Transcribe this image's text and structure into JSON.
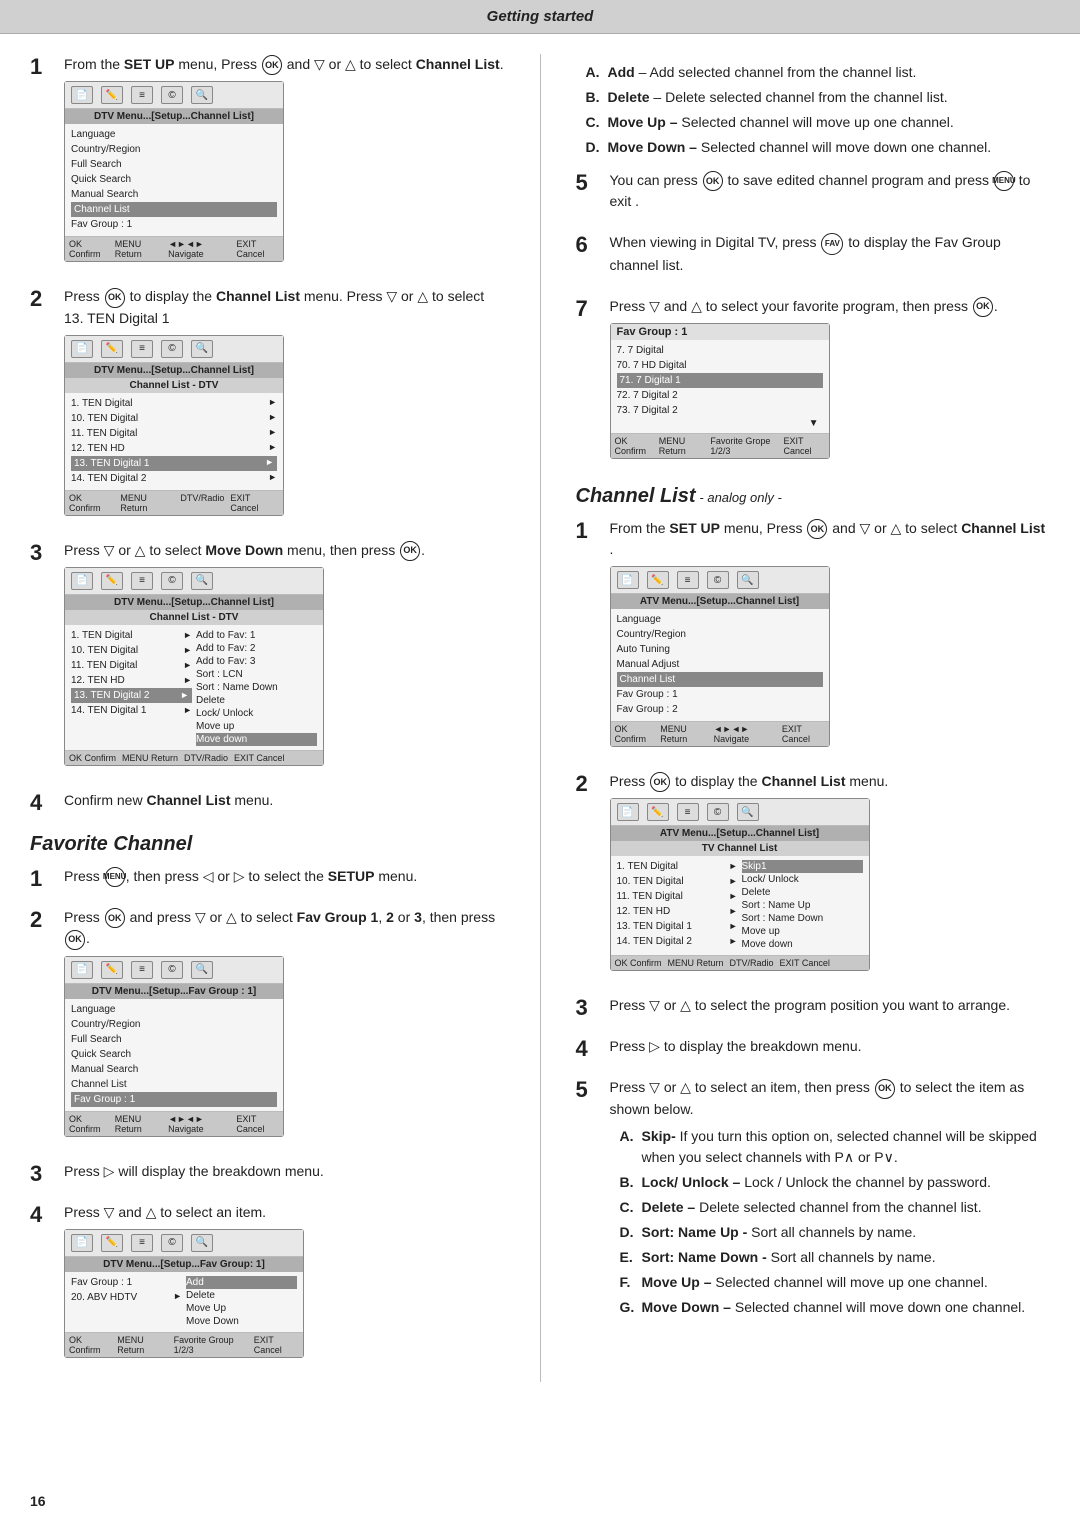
{
  "header": {
    "title": "Getting started"
  },
  "page_number": "16",
  "left": {
    "steps": [
      {
        "number": "1",
        "text_before": "From the ",
        "bold1": "SET UP",
        "text_mid": " menu, Press ",
        "ok_label": "OK",
        "text_mid2": " and ▽ or △ to select ",
        "bold2": "Channel List",
        "text_after": ".",
        "screen": {
          "title": "DTV Menu...[Setup...Channel List]",
          "rows": [
            {
              "label": "Language",
              "arrow": ""
            },
            {
              "label": "Country/Region",
              "arrow": ""
            },
            {
              "label": "Full Search",
              "arrow": ""
            },
            {
              "label": "Quick Search",
              "arrow": ""
            },
            {
              "label": "Manual Search",
              "arrow": ""
            },
            {
              "label": "Channel List",
              "arrow": "",
              "highlighted": true
            },
            {
              "label": "Fav Group : 1",
              "arrow": ""
            }
          ],
          "footer": "OK Confirm  MENU Return  ◄►◄► Navigate  EXIT Cancel"
        }
      },
      {
        "number": "2",
        "text_before": "Press ",
        "ok_label": "OK",
        "text_mid": " to display the ",
        "bold1": "Channel List",
        "text_mid2": " menu. Press ▽ or △ to select 13. TEN Digital 1",
        "screen": {
          "title": "DTV Menu...[Setup...Channel List]",
          "subtitle": "Channel List - DTV",
          "rows": [
            {
              "label": "1. TEN Digital",
              "arrow": "►"
            },
            {
              "label": "10. TEN Digital",
              "arrow": "►"
            },
            {
              "label": "11. TEN Digital",
              "arrow": "►"
            },
            {
              "label": "12. TEN HD",
              "arrow": "►"
            },
            {
              "label": "13. TEN Digital 1",
              "arrow": "►",
              "highlighted": true
            },
            {
              "label": "14. TEN Digital 2",
              "arrow": "►"
            }
          ],
          "footer": "OK Confirm  MENU Return     DTV/Radio  EXIT Cancel"
        }
      },
      {
        "number": "3",
        "text_before": "Press ▽ or △ to select ",
        "bold1": "Move Down",
        "text_mid": " menu, then press ",
        "ok_label": "OK",
        "text_after": ".",
        "screen": {
          "title": "DTV Menu...[Setup...Channel List]",
          "subtitle": "Channel List - DTV",
          "rows": [
            {
              "label": "1. TEN Digital",
              "submenu": "Add to Fav: 1"
            },
            {
              "label": "10. TEN Digital",
              "submenu": "Add to Fav: 2"
            },
            {
              "label": "11. TEN Digital",
              "submenu": "Add to Fav: 3"
            },
            {
              "label": "12. TEN HD",
              "submenu": "Sort : LCN"
            },
            {
              "label": "13. TEN Digital 2",
              "submenu": "Sort : Name Down",
              "highlighted": true
            },
            {
              "label": "14. TEN Digital 1",
              "submenu": "Delete"
            }
          ],
          "submenu_extra": [
            "Lock/ Unlock",
            "Move up",
            "Move down"
          ],
          "footer": "OK Confirm  MENU Return     DTV/Radio  EXIT Cancel"
        }
      },
      {
        "number": "4",
        "text": "Confirm new ",
        "bold1": "Channel List",
        "text2": " menu."
      }
    ],
    "favorite_channel": {
      "heading": "Favorite Channel",
      "steps": [
        {
          "number": "1",
          "text_before": "Press ",
          "menu_label": "MENU",
          "text_mid": ", then press ◁ or ▷ to select the ",
          "bold1": "SETUP",
          "text_after": " menu."
        },
        {
          "number": "2",
          "text_before": "Press ",
          "ok_label": "OK",
          "text_mid": " and press ▽ or △ to select ",
          "bold1": "Fav Group 1",
          "text_mid2": ", ",
          "bold2": "2",
          "text_mid3": " or ",
          "bold3": "3",
          "text_after": ", then press ",
          "ok_label2": "OK",
          "text_after2": ".",
          "screen": {
            "title": "DTV Menu...[Setup...Fav Group : 1]",
            "rows": [
              {
                "label": "Language"
              },
              {
                "label": "Country/Region"
              },
              {
                "label": "Full Search"
              },
              {
                "label": "Quick Search"
              },
              {
                "label": "Manual Search"
              },
              {
                "label": "Channel List"
              },
              {
                "label": "Fav Group : 1",
                "highlighted": true
              }
            ],
            "footer": "OK Confirm  MENU Return  ◄►◄► Navigate  EXIT Cancel"
          }
        },
        {
          "number": "3",
          "text_before": "Press ▷ will display the breakdown menu."
        },
        {
          "number": "4",
          "text_before": "Press ▽ and △ to select an item.",
          "screen": {
            "title": "DTV Menu...[Setup...Fav Group: 1]",
            "rows_left": [
              {
                "label": "Fav Group : 1"
              },
              {
                "label": "20. ABV HDTV",
                "arrow": "►"
              }
            ],
            "submenu": [
              "Add",
              "Delete",
              "Move Up",
              "Move Down"
            ],
            "footer": "OK Confirm  MENU Return     Favorite Group 1/2/3  EXIT Cancel"
          }
        }
      ]
    }
  },
  "right": {
    "list_items": [
      {
        "label": "A.",
        "bold": "Add",
        "text": " – Add selected channel from the channel list."
      },
      {
        "label": "B.",
        "bold": "Delete",
        "text": " – Delete selected channel from the channel list."
      },
      {
        "label": "C.",
        "bold": "Move Up –",
        "text": " Selected channel will move up one channel."
      },
      {
        "label": "D.",
        "bold": "Move Down –",
        "text": " Selected channel will move down one channel."
      }
    ],
    "steps_5_7": [
      {
        "number": "5",
        "text_before": "You can press ",
        "ok_label": "OK",
        "text_mid": " to save edited channel program and press ",
        "menu_label": "MENU",
        "text_after": " to exit ."
      },
      {
        "number": "6",
        "text_before": "When viewing in Digital TV, press ",
        "fav_label": "FAV",
        "text_after": " to display the Fav Group channel list."
      },
      {
        "number": "7",
        "text_before": "Press ▽ and △ to select your favorite program, then press ",
        "ok_label": "OK",
        "text_after": ".",
        "screen": {
          "title": "Fav Group : 1",
          "rows": [
            {
              "label": "7. 7 Digital"
            },
            {
              "label": "70. 7 HD Digital"
            },
            {
              "label": "71. 7 Digital 1"
            },
            {
              "label": "72. 7 Digital 2"
            },
            {
              "label": "73. 7 Digital 2"
            }
          ],
          "footer": "OK Confirm  MENU Return     Favorite Grope 1/2/3  EXIT Cancel"
        }
      }
    ],
    "channel_list_heading": "Channel List",
    "channel_list_subheading": "- analog only -",
    "channel_list_steps": [
      {
        "number": "1",
        "text_before": "From the ",
        "bold1": "SET UP",
        "text_mid": " menu, Press ",
        "ok_label": "OK",
        "text_mid2": " and ▽ or △ to select ",
        "bold2": "Channel List",
        "text_after": " .",
        "screen": {
          "title": "ATV Menu...[Setup...Channel List]",
          "rows": [
            {
              "label": "Language"
            },
            {
              "label": "Country/Region"
            },
            {
              "label": "Auto Tuning"
            },
            {
              "label": "Manual Adjust"
            },
            {
              "label": "Channel List",
              "highlighted": true
            },
            {
              "label": "Fav Group : 1"
            },
            {
              "label": "Fav Group : 2"
            }
          ],
          "footer": "OK Confirm  MENU Return  ◄►◄► Navigate  EXIT Cancel"
        }
      },
      {
        "number": "2",
        "text_before": "Press ",
        "ok_label": "OK",
        "text_after": " to display the ",
        "bold1": "Channel List",
        "text_after2": " menu.",
        "screen": {
          "title": "ATV Menu...[Setup...Channel List]",
          "subtitle": "TV Channel List",
          "rows": [
            {
              "label": "1. TEN Digital",
              "submenu": "Skip1"
            },
            {
              "label": "10. TEN Digital",
              "submenu": "Lock/ Unlock"
            },
            {
              "label": "11. TEN Digital",
              "submenu": "Delete"
            },
            {
              "label": "12. TEN HD",
              "submenu": "Sort : Name Up"
            },
            {
              "label": "13. TEN Digital 1",
              "submenu": "Sort : Name Down"
            },
            {
              "label": "14. TEN Digital 2",
              "submenu": "Move up"
            }
          ],
          "submenu_extra": [
            "Move down"
          ],
          "footer": "OK Confirm  MENU Return     DTV/Radio  EXIT Cancel"
        }
      },
      {
        "number": "3",
        "text": "Press ▽ or △  to select the program position you want to arrange."
      },
      {
        "number": "4",
        "text": "Press ▷ to display the breakdown menu."
      },
      {
        "number": "5",
        "text_before": "Press ▽ or △  to select an item, then press ",
        "ok_label": "OK",
        "text_after": " to select the item as shown below.",
        "list_items": [
          {
            "label": "A.",
            "bold": "Skip-",
            "text": " If you turn this option on, selected channel will be skipped when you select channels with P∧ or P∨."
          },
          {
            "label": "B.",
            "bold": "Lock/ Unlock –",
            "text": " Lock / Unlock the channel by password."
          },
          {
            "label": "C.",
            "bold": "Delete –",
            "text": " Delete selected channel from the channel list."
          },
          {
            "label": "D.",
            "bold": "Sort: Name Up -",
            "text": " Sort all channels by name."
          },
          {
            "label": "E.",
            "bold": "Sort: Name Down -",
            "text": " Sort all channels by name."
          },
          {
            "label": "F.",
            "bold": "Move Up –",
            "text": " Selected channel will move up one channel."
          },
          {
            "label": "G.",
            "bold": "Move Down –",
            "text": " Selected channel will move down one channel."
          }
        ]
      }
    ]
  }
}
